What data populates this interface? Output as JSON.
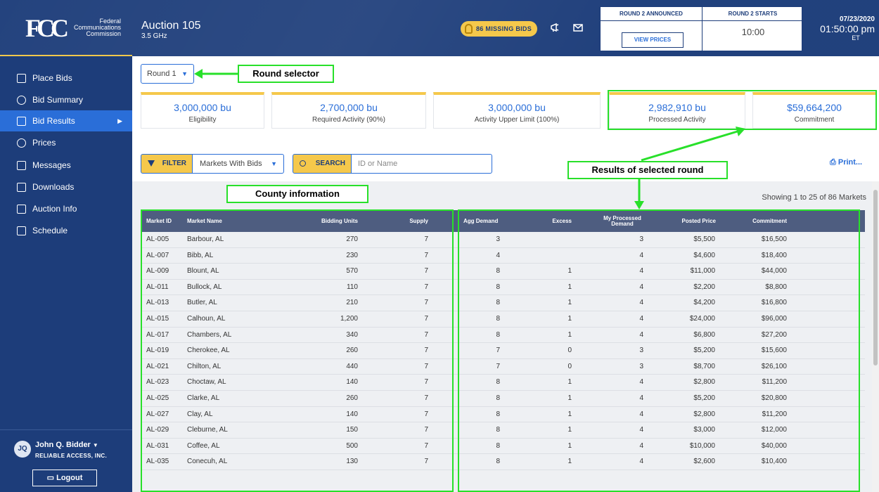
{
  "header": {
    "logo_text": "FCC",
    "org_line1": "Federal",
    "org_line2": "Communications",
    "org_line3": "Commission",
    "auction_title": "Auction 105",
    "auction_sub": "3.5 GHz",
    "missing_bids": "86 MISSING BIDS",
    "round_announced_label": "ROUND 2 ANNOUNCED",
    "view_prices_label": "VIEW PRICES",
    "round_starts_label": "ROUND 2 STARTS",
    "round_start_time": "10:00",
    "date": "07/23/2020",
    "time": "01:50:00 pm",
    "timezone": "ET"
  },
  "sidebar": {
    "items": [
      {
        "label": "Place Bids"
      },
      {
        "label": "Bid Summary"
      },
      {
        "label": "Bid Results"
      },
      {
        "label": "Prices"
      },
      {
        "label": "Messages"
      },
      {
        "label": "Downloads"
      },
      {
        "label": "Auction Info"
      },
      {
        "label": "Schedule"
      }
    ],
    "user_initials": "JQ",
    "user_name": "John Q. Bidder",
    "user_org": "RELIABLE ACCESS, INC.",
    "logout_label": "Logout"
  },
  "round_selector": {
    "value": "Round 1"
  },
  "summary_cards": [
    {
      "value": "3,000,000 bu",
      "label": "Eligibility"
    },
    {
      "value": "2,700,000 bu",
      "label": "Required Activity (90%)"
    },
    {
      "value": "3,000,000 bu",
      "label": "Activity Upper Limit (100%)"
    },
    {
      "value": "2,982,910 bu",
      "label": "Processed Activity"
    },
    {
      "value": "$59,664,200",
      "label": "Commitment"
    }
  ],
  "filter": {
    "button_label": "FILTER",
    "selected": "Markets With Bids"
  },
  "search": {
    "button_label": "SEARCH",
    "placeholder": "ID or Name"
  },
  "print_label": "Print...",
  "showing_text": "Showing 1 to 25 of 86 Markets",
  "annotations": {
    "round_selector": "Round selector",
    "county_info": "County information",
    "results": "Results of selected round"
  },
  "table": {
    "headers": [
      "Market ID",
      "Market Name",
      "Bidding Units",
      "Supply",
      "Agg Demand",
      "Excess",
      "My Processed Demand",
      "Posted Price",
      "Commitment"
    ],
    "rows": [
      [
        "AL-005",
        "Barbour, AL",
        "270",
        "7",
        "3",
        "",
        "3",
        "$5,500",
        "$16,500"
      ],
      [
        "AL-007",
        "Bibb, AL",
        "230",
        "7",
        "4",
        "",
        "4",
        "$4,600",
        "$18,400"
      ],
      [
        "AL-009",
        "Blount, AL",
        "570",
        "7",
        "8",
        "1",
        "4",
        "$11,000",
        "$44,000"
      ],
      [
        "AL-011",
        "Bullock, AL",
        "110",
        "7",
        "8",
        "1",
        "4",
        "$2,200",
        "$8,800"
      ],
      [
        "AL-013",
        "Butler, AL",
        "210",
        "7",
        "8",
        "1",
        "4",
        "$4,200",
        "$16,800"
      ],
      [
        "AL-015",
        "Calhoun, AL",
        "1,200",
        "7",
        "8",
        "1",
        "4",
        "$24,000",
        "$96,000"
      ],
      [
        "AL-017",
        "Chambers, AL",
        "340",
        "7",
        "8",
        "1",
        "4",
        "$6,800",
        "$27,200"
      ],
      [
        "AL-019",
        "Cherokee, AL",
        "260",
        "7",
        "7",
        "0",
        "3",
        "$5,200",
        "$15,600"
      ],
      [
        "AL-021",
        "Chilton, AL",
        "440",
        "7",
        "7",
        "0",
        "3",
        "$8,700",
        "$26,100"
      ],
      [
        "AL-023",
        "Choctaw, AL",
        "140",
        "7",
        "8",
        "1",
        "4",
        "$2,800",
        "$11,200"
      ],
      [
        "AL-025",
        "Clarke, AL",
        "260",
        "7",
        "8",
        "1",
        "4",
        "$5,200",
        "$20,800"
      ],
      [
        "AL-027",
        "Clay, AL",
        "140",
        "7",
        "8",
        "1",
        "4",
        "$2,800",
        "$11,200"
      ],
      [
        "AL-029",
        "Cleburne, AL",
        "150",
        "7",
        "8",
        "1",
        "4",
        "$3,000",
        "$12,000"
      ],
      [
        "AL-031",
        "Coffee, AL",
        "500",
        "7",
        "8",
        "1",
        "4",
        "$10,000",
        "$40,000"
      ],
      [
        "AL-035",
        "Conecuh, AL",
        "130",
        "7",
        "8",
        "1",
        "4",
        "$2,600",
        "$10,400"
      ]
    ]
  }
}
